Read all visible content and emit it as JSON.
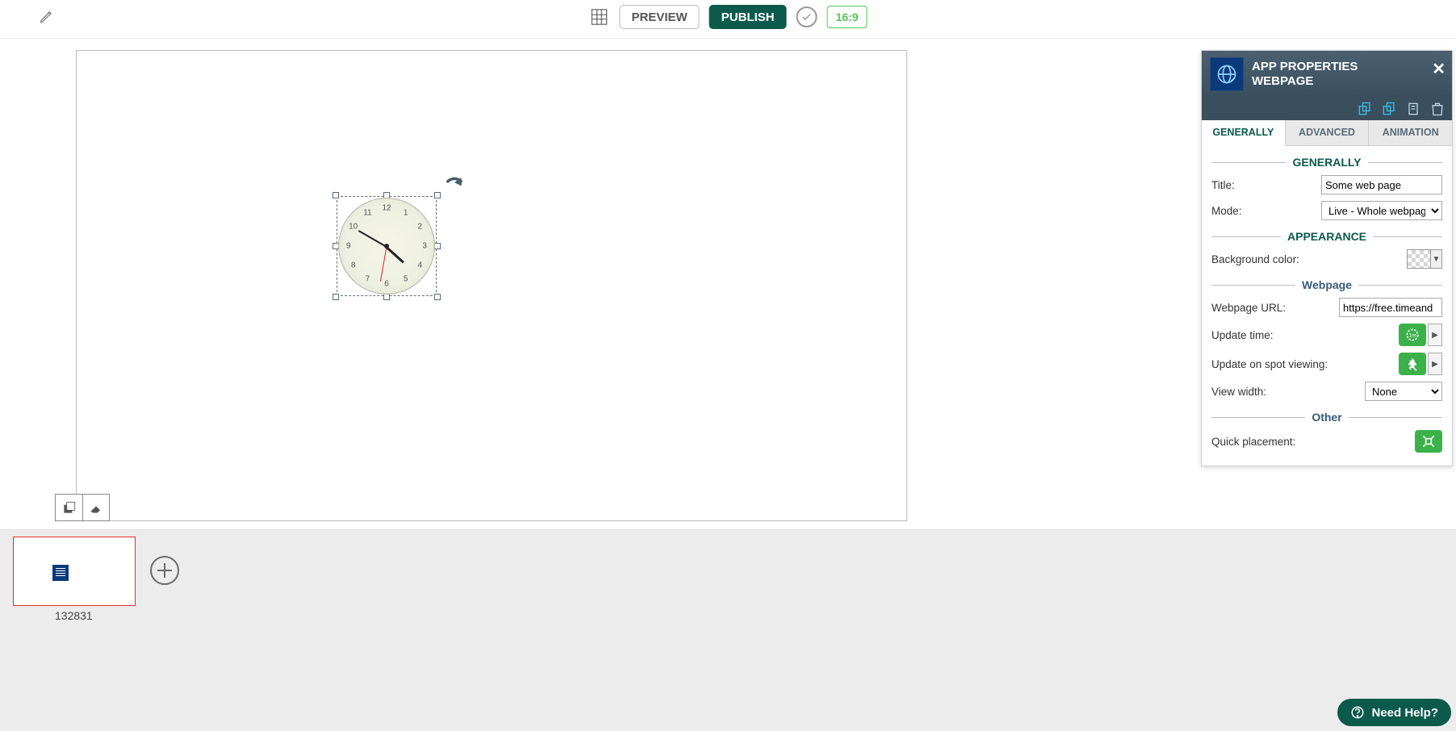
{
  "topbar": {
    "preview": "PREVIEW",
    "publish": "PUBLISH",
    "ratio": "16:9"
  },
  "slides": {
    "current_id": "132831"
  },
  "panel": {
    "title1": "APP PROPERTIES",
    "title2": "WEBPAGE",
    "tabs": {
      "generally": "GENERALLY",
      "advanced": "ADVANCED",
      "animation": "ANIMATION"
    },
    "sections": {
      "generally": "GENERALLY",
      "appearance": "APPEARANCE",
      "webpage": "Webpage",
      "other": "Other"
    },
    "labels": {
      "title": "Title:",
      "mode": "Mode:",
      "bg": "Background color:",
      "url": "Webpage URL:",
      "update_time": "Update time:",
      "update_spot": "Update on spot viewing:",
      "view_width": "View width:",
      "quick": "Quick placement:"
    },
    "values": {
      "title": "Some web page",
      "mode": "Live - Whole webpage",
      "url": "https://free.timeand",
      "view_width": "None"
    }
  },
  "help": {
    "label": "Need Help?"
  }
}
